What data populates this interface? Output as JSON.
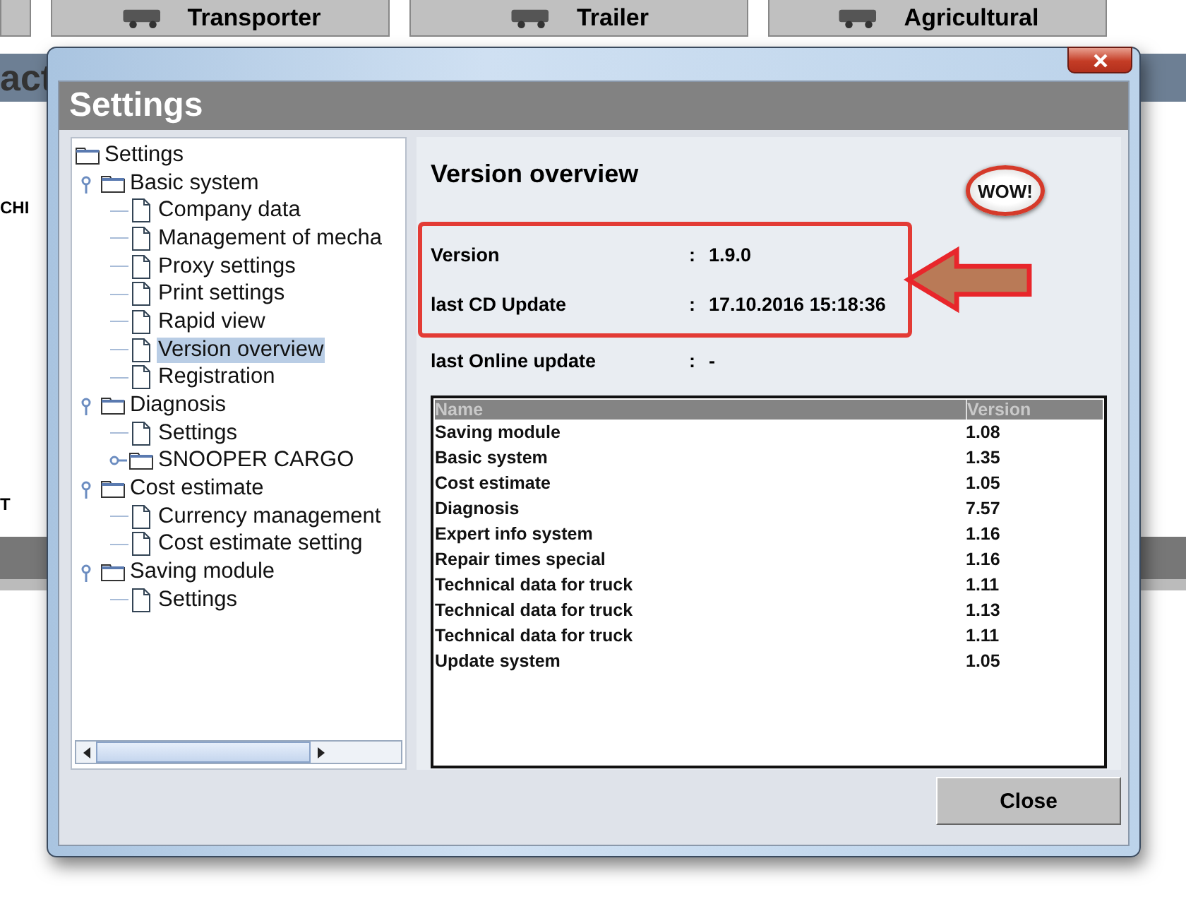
{
  "background": {
    "tabs": [
      {
        "label": "Transporter"
      },
      {
        "label": "Trailer"
      },
      {
        "label": "Agricultural"
      }
    ],
    "heading": "act",
    "texts": [
      "CHI",
      "T"
    ]
  },
  "dialog": {
    "title": "Settings",
    "tree": [
      {
        "label": "Settings",
        "kind": "folder",
        "selected": false,
        "children": [
          {
            "label": "Basic system",
            "kind": "folder",
            "expanded": true,
            "selected": false,
            "children": [
              {
                "label": "Company data",
                "kind": "document",
                "selected": false
              },
              {
                "label": "Management of mecha",
                "kind": "document",
                "selected": false
              },
              {
                "label": "Proxy settings",
                "kind": "document",
                "selected": false
              },
              {
                "label": "Print settings",
                "kind": "document",
                "selected": false
              },
              {
                "label": "Rapid view",
                "kind": "document",
                "selected": false
              },
              {
                "label": "Version overview",
                "kind": "document",
                "selected": true
              },
              {
                "label": "Registration",
                "kind": "document",
                "selected": false
              }
            ]
          },
          {
            "label": "Diagnosis",
            "kind": "folder",
            "expanded": true,
            "selected": false,
            "children": [
              {
                "label": "Settings",
                "kind": "document",
                "selected": false
              },
              {
                "label": "SNOOPER CARGO",
                "kind": "folder",
                "expanded": false,
                "selected": false
              }
            ]
          },
          {
            "label": "Cost estimate",
            "kind": "folder",
            "expanded": true,
            "selected": false,
            "children": [
              {
                "label": "Currency management",
                "kind": "document",
                "selected": false
              },
              {
                "label": "Cost estimate setting",
                "kind": "document",
                "selected": false
              }
            ]
          },
          {
            "label": "Saving module",
            "kind": "folder",
            "expanded": true,
            "selected": false,
            "children": [
              {
                "label": "Settings",
                "kind": "document",
                "selected": false
              }
            ]
          }
        ]
      }
    ],
    "panel": {
      "title": "Version overview",
      "logo": "WOW!",
      "info": [
        {
          "label": "Version",
          "sep": ":",
          "value": "1.9.0",
          "highlighted": true
        },
        {
          "label": "last CD Update",
          "sep": ":",
          "value": "17.10.2016 15:18:36",
          "highlighted": true
        },
        {
          "label": "last Online update",
          "sep": ":",
          "value": "-",
          "highlighted": false
        }
      ],
      "table": {
        "columns": [
          "Name",
          "Version"
        ],
        "rows": [
          [
            "Saving module",
            "1.08"
          ],
          [
            "Basic system",
            "1.35"
          ],
          [
            "Cost estimate",
            "1.05"
          ],
          [
            "Diagnosis",
            "7.57"
          ],
          [
            "Expert info system",
            "1.16"
          ],
          [
            "Repair times special",
            "1.16"
          ],
          [
            "Technical data for truck",
            "1.11"
          ],
          [
            "Technical data for truck",
            "1.13"
          ],
          [
            "Technical data for truck",
            "1.11"
          ],
          [
            "Update system",
            "1.05"
          ]
        ]
      }
    },
    "buttons": [
      {
        "label": "Close"
      }
    ]
  }
}
